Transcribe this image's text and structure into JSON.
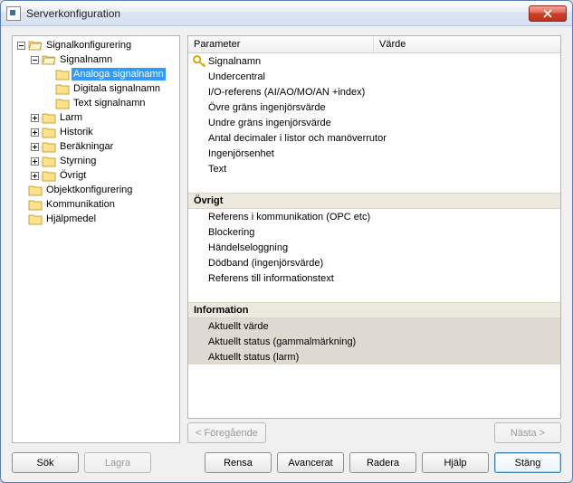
{
  "window": {
    "title": "Serverkonfiguration"
  },
  "tree": {
    "root": {
      "label": "Signalkonfigurering",
      "children": {
        "signalnamn": {
          "label": "Signalnamn",
          "children": {
            "analoga": "Analoga signalnamn",
            "digitala": "Digitala signalnamn",
            "text": "Text signalnamn"
          }
        },
        "larm": "Larm",
        "historik": "Historik",
        "berakningar": "Beräkningar",
        "styrning": "Styrning",
        "ovrigt": "Övrigt"
      }
    },
    "objektkonfigurering": "Objektkonfigurering",
    "kommunikation": "Kommunikation",
    "hjalpmedel": "Hjälpmedel"
  },
  "params": {
    "columns": {
      "parameter": "Parameter",
      "value": "Värde"
    },
    "rows": [
      "Signalnamn",
      "Undercentral",
      "I/O-referens (AI/AO/MO/AN +index)",
      "Övre gräns ingenjörsvärde",
      "Undre gräns ingenjörsvärde",
      "Antal decimaler i listor och manöverrutor",
      "Ingenjörsenhet",
      "Text"
    ],
    "section_ovrigt": "Övrigt",
    "rows_ovrigt": [
      "Referens i kommunikation (OPC etc)",
      "Blockering",
      "Händelseloggning",
      "Dödband (ingenjörsvärde)",
      "Referens till informationstext"
    ],
    "section_info": "Information",
    "rows_info": [
      "Aktuellt värde",
      "Aktuellt status (gammalmärkning)",
      "Aktuellt status (larm)"
    ]
  },
  "nav": {
    "prev": "< Föregående",
    "next": "Nästa >"
  },
  "buttons": {
    "search": "Sök",
    "store": "Lagra",
    "clear": "Rensa",
    "advanced": "Avancerat",
    "delete": "Radera",
    "help": "Hjälp",
    "close": "Stäng"
  }
}
